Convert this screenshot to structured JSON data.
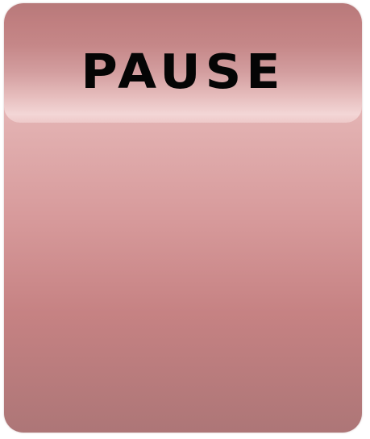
{
  "pause_menu": {
    "title": "PAUSE"
  },
  "colors": {
    "panel_top": "#ecc7c7",
    "panel_bottom": "#ad7677",
    "header_top": "#b7797a",
    "header_highlight": "#f3d6d6",
    "title_text": "#050505"
  }
}
